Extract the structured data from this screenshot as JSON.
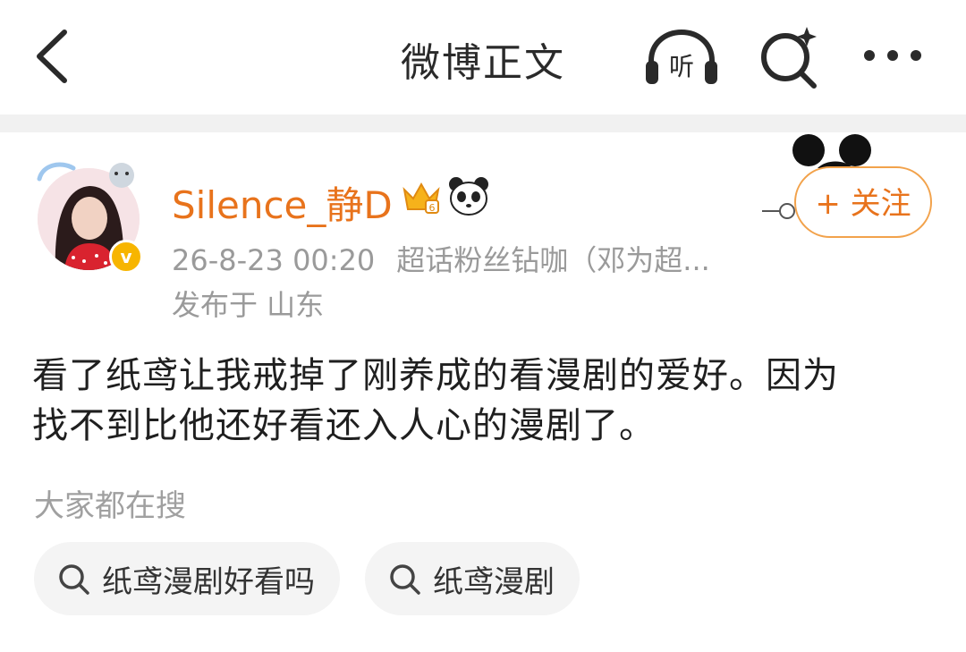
{
  "header": {
    "title": "微博正文",
    "listen_label": "听"
  },
  "post": {
    "author": {
      "name": "Silence_静D",
      "verified_mark": "v"
    },
    "timestamp": "26-8-23 00:20",
    "source": "超话粉丝钻咖（邓为超...",
    "location": "发布于 山东",
    "follow_label": "+ 关注",
    "text_lines": [
      "看了纸鸢让我戒掉了刚养成的看漫剧的爱好。因为",
      "找不到比他还好看还入人心的漫剧了。"
    ]
  },
  "search": {
    "label": "大家都在搜",
    "chips": [
      "纸鸢漫剧好看吗",
      "纸鸢漫剧"
    ]
  },
  "colors": {
    "username": "#e8731c",
    "follow_border": "#f2a24b",
    "meta_text": "#9a9a9a",
    "divider": "#f1f1f1",
    "verified_badge": "#f7b500"
  },
  "icons": [
    "back-arrow-icon",
    "headphones-icon",
    "search-sparkle-icon",
    "more-dots-icon",
    "crown-level-icon",
    "panda-icon",
    "search-icon"
  ]
}
